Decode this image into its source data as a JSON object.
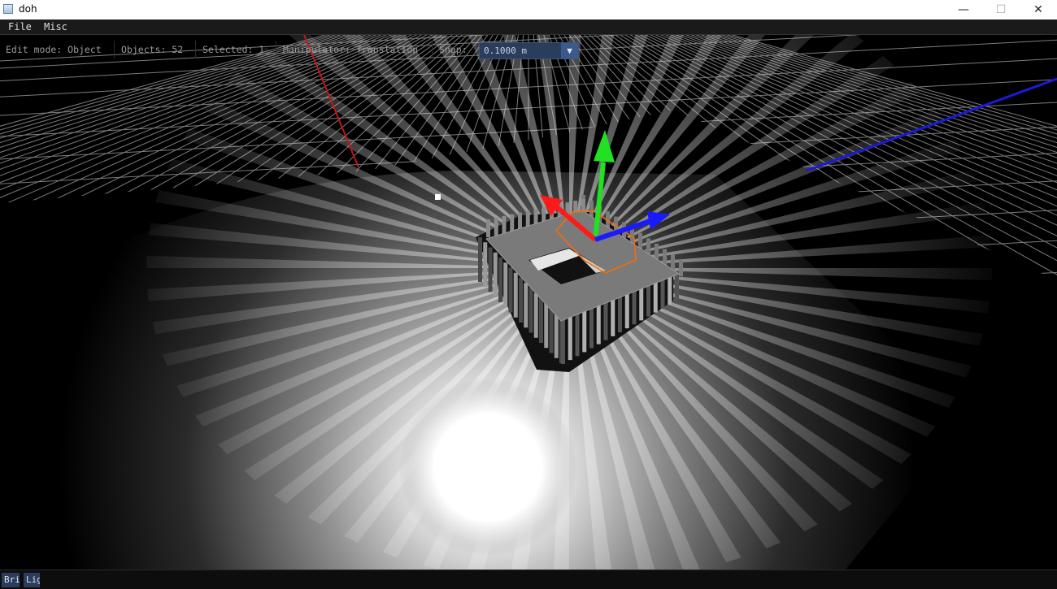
{
  "window": {
    "title": "doh",
    "minimize_glyph": "—",
    "maximize_glyph": "☐",
    "close_glyph": "✕"
  },
  "menu": {
    "items": [
      "File",
      "Misc"
    ]
  },
  "toolbar": {
    "edit_mode": "Edit mode: Object",
    "objects": "Objects: 52",
    "selected": "Selected: 1",
    "manipulator": "Manipulator: Translation",
    "snap_label": "Snap:",
    "snap_value": "0.1000 m",
    "snap_arrow": "▼"
  },
  "bottom_tabs": [
    "Bri",
    "Lig"
  ],
  "colors": {
    "grid": "#8a8a8a",
    "axis_x": "#d02020",
    "axis_z": "#2020e0",
    "gizmo_x": "#ff1a1a",
    "gizmo_y": "#22e022",
    "gizmo_z": "#1a1aff",
    "selection": "#ff6a00",
    "combo_bg": "#2a3d5c"
  },
  "icons": {
    "app": "window-app-icon",
    "combo": "chevron-down-icon"
  }
}
